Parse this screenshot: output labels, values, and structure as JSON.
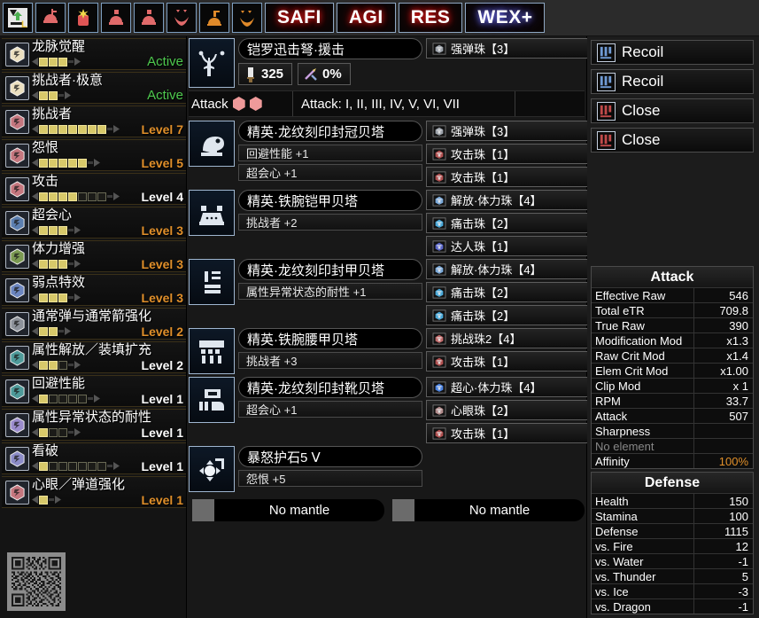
{
  "toolbar": {
    "icons": [
      {
        "name": "set-search-icon",
        "glyph": "L"
      },
      {
        "name": "head-armor-icon",
        "glyph": ""
      },
      {
        "name": "charm-icon",
        "glyph": ""
      },
      {
        "name": "chest-armor-icon",
        "glyph": ""
      },
      {
        "name": "arms-armor-icon",
        "glyph": ""
      },
      {
        "name": "waist-armor-icon",
        "glyph": ""
      },
      {
        "name": "legs-armor-icon",
        "glyph": ""
      },
      {
        "name": "mantle-icon",
        "glyph": ""
      }
    ],
    "buttons": [
      {
        "label": "SAFI",
        "style": "red"
      },
      {
        "label": "AGI",
        "style": "red"
      },
      {
        "label": "RES",
        "style": "red"
      },
      {
        "label": "WEX+",
        "style": "blue"
      }
    ]
  },
  "skills": [
    {
      "name": "龙脉觉醒",
      "level_text": "Active",
      "state": "active",
      "filled": 3,
      "total": 3,
      "icon_color": "#ece0c0",
      "rail": true
    },
    {
      "name": "挑战者·极意",
      "level_text": "Active",
      "state": "active",
      "filled": 2,
      "total": 2,
      "icon_color": "#ece0c0",
      "rail": true
    },
    {
      "name": "挑战者",
      "level_text": "Level 7",
      "state": "partial",
      "filled": 7,
      "total": 7,
      "icon_color": "#c5777f",
      "rail": true
    },
    {
      "name": "怨恨",
      "level_text": "Level 5",
      "state": "partial",
      "filled": 5,
      "total": 5,
      "icon_color": "#c5777f",
      "rail": true
    },
    {
      "name": "攻击",
      "level_text": "Level 4",
      "state": "max",
      "filled": 4,
      "total": 7,
      "icon_color": "#c5777f",
      "rail": true
    },
    {
      "name": "超会心",
      "level_text": "Level 3",
      "state": "partial",
      "filled": 3,
      "total": 3,
      "icon_color": "#5c7fb0",
      "rail": true
    },
    {
      "name": "体力增强",
      "level_text": "Level 3",
      "state": "partial",
      "filled": 3,
      "total": 3,
      "icon_color": "#7b9a52",
      "rail": true
    },
    {
      "name": "弱点特效",
      "level_text": "Level 3",
      "state": "partial",
      "filled": 3,
      "total": 3,
      "icon_color": "#6c86c0",
      "rail": true
    },
    {
      "name": "通常弹与通常箭强化",
      "level_text": "Level 2",
      "state": "partial",
      "filled": 2,
      "total": 2,
      "icon_color": "#8d929a",
      "rail": true
    },
    {
      "name": "属性解放／装填扩充",
      "level_text": "Level 2",
      "state": "max",
      "filled": 2,
      "total": 3,
      "icon_color": "#4e9a9a",
      "rail": true
    },
    {
      "name": "回避性能",
      "level_text": "Level 1",
      "state": "max",
      "filled": 1,
      "total": 5,
      "icon_color": "#4e9a9a",
      "rail": true
    },
    {
      "name": "属性异常状态的耐性",
      "level_text": "Level 1",
      "state": "max",
      "filled": 1,
      "total": 3,
      "icon_color": "#9b8ccd",
      "rail": true
    },
    {
      "name": "看破",
      "level_text": "Level 1",
      "state": "max",
      "filled": 1,
      "total": 7,
      "icon_color": "#8c8cc8",
      "rail": true
    },
    {
      "name": "心眼／弹道强化",
      "level_text": "Level 1",
      "state": "partial",
      "filled": 1,
      "total": 1,
      "icon_color": "#c5777f",
      "rail": true
    }
  ],
  "weapon": {
    "name": "铠罗迅击弩·援击",
    "attack_value": "325",
    "affinity_value": "0%",
    "attack_icon": "attack-icon",
    "affinity_icon": "affinity-icon",
    "decorations": [
      {
        "label": "强弹珠【3】",
        "color": "#9aa0a8"
      }
    ],
    "augment_row": {
      "left_label": "Attack",
      "hex_count": 2,
      "middle_label": "Attack: I, II, III, IV, V, VI, VII"
    }
  },
  "armor": [
    {
      "name": "精英·龙纹刻印封冠贝塔",
      "icon": "helmet-icon",
      "skills": [
        "回避性能 +1",
        "超会心 +1"
      ],
      "decorations": [
        {
          "label": "强弹珠【3】",
          "color": "#9aa0a8"
        },
        {
          "label": "攻击珠【1】",
          "color": "#b05050"
        },
        {
          "label": "攻击珠【1】",
          "color": "#b05050"
        }
      ]
    },
    {
      "name": "精英·铁腕铠甲贝塔",
      "icon": "chest-icon",
      "skills": [
        "挑战者 +2"
      ],
      "decorations": [
        {
          "label": "解放·体力珠【4】",
          "color": "#7aa8d8"
        },
        {
          "label": "痛击珠【2】",
          "color": "#49a8d8"
        },
        {
          "label": "达人珠【1】",
          "color": "#5a66c8"
        }
      ]
    },
    {
      "name": "精英·龙纹刻印封甲贝塔",
      "icon": "arms-icon",
      "skills": [
        "属性异常状态的耐性 +1"
      ],
      "decorations": [
        {
          "label": "解放·体力珠【4】",
          "color": "#7aa8d8"
        },
        {
          "label": "痛击珠【2】",
          "color": "#49a8d8"
        },
        {
          "label": "痛击珠【2】",
          "color": "#49a8d8"
        }
      ]
    },
    {
      "name": "精英·铁腕腰甲贝塔",
      "icon": "waist-icon",
      "skills": [
        "挑战者 +3"
      ],
      "decorations": [
        {
          "label": "挑战珠2【4】",
          "color": "#c06a6a"
        },
        {
          "label": "攻击珠【1】",
          "color": "#b05050"
        }
      ]
    },
    {
      "name": "精英·龙纹刻印封靴贝塔",
      "icon": "legs-icon",
      "skills": [
        "超会心 +1"
      ],
      "decorations": [
        {
          "label": "超心·体力珠【4】",
          "color": "#4a82e0"
        },
        {
          "label": "心眼珠【2】",
          "color": "#b08a8a"
        },
        {
          "label": "攻击珠【1】",
          "color": "#b05050"
        }
      ]
    },
    {
      "name": "暴怒护石5 Ⅴ",
      "icon": "charm-icon",
      "skills": [
        "怨恨 +5"
      ],
      "decorations": []
    }
  ],
  "mantles": [
    {
      "label": "No mantle"
    },
    {
      "label": "No mantle"
    }
  ],
  "mods": [
    {
      "label": "Recoil",
      "color": "#6f9ad4"
    },
    {
      "label": "Recoil",
      "color": "#6f9ad4"
    },
    {
      "label": "Close",
      "color": "#c04a4a"
    },
    {
      "label": "Close",
      "color": "#c04a4a"
    }
  ],
  "attack_stats": {
    "title": "Attack",
    "rows": [
      {
        "key": "Effective Raw",
        "value": "546"
      },
      {
        "key": "Total eTR",
        "value": "709.8"
      },
      {
        "key": "True Raw",
        "value": "390"
      },
      {
        "key": "Modification Mod",
        "value": "x1.3"
      },
      {
        "key": "Raw Crit Mod",
        "value": "x1.4"
      },
      {
        "key": "Elem Crit Mod",
        "value": "x1.00"
      },
      {
        "key": "Clip Mod",
        "value": "x 1"
      },
      {
        "key": "RPM",
        "value": "33.7"
      },
      {
        "key": "Attack",
        "value": "507"
      },
      {
        "key": "Sharpness",
        "value": ""
      },
      {
        "key": "No element",
        "value": "",
        "dim": true
      },
      {
        "key": "Affinity",
        "value": "100%",
        "accent": true
      }
    ]
  },
  "defense_stats": {
    "title": "Defense",
    "rows": [
      {
        "key": "Health",
        "value": "150"
      },
      {
        "key": "Stamina",
        "value": "100"
      },
      {
        "key": "Defense",
        "value": "1115"
      },
      {
        "key": "vs. Fire",
        "value": "12"
      },
      {
        "key": "vs. Water",
        "value": "-1"
      },
      {
        "key": "vs. Thunder",
        "value": "5"
      },
      {
        "key": "vs. Ice",
        "value": "-3"
      },
      {
        "key": "vs. Dragon",
        "value": "-1"
      }
    ]
  }
}
